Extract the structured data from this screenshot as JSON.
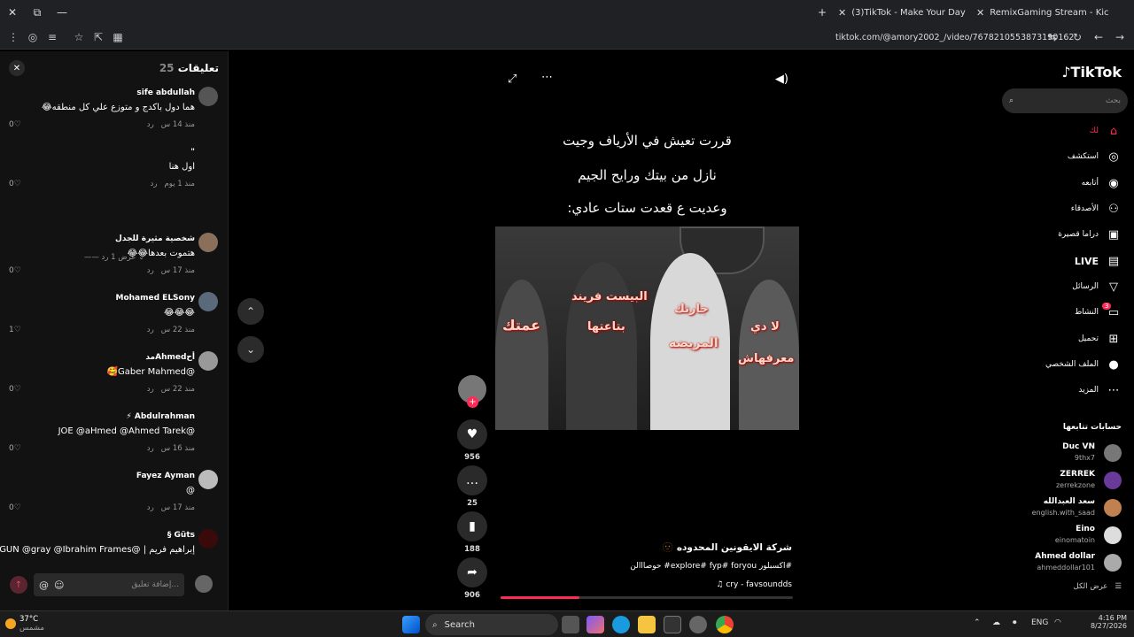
{
  "browser": {
    "tabs": [
      {
        "title": "(3)TikTok - Make Your Day",
        "active": true
      },
      {
        "title": "RemixGaming Stream - Kick Da",
        "active": false
      }
    ],
    "url": "tiktok.com/@amory2002_/video/7678210553873190162"
  },
  "comments": {
    "title": "تعليقات",
    "count": "25",
    "items": [
      {
        "user": "sife abdullah",
        "text": "هما دول باكدج و متوزع علي كل منطقه😂",
        "time": "منذ 14 س",
        "reply": "رد",
        "likes": "0"
      },
      {
        "user": "\"",
        "text": "اول هنا",
        "time": "منذ 1 يوم",
        "reply": "رد",
        "likes": "0"
      },
      {
        "user": "شخصية مثيرة للجدل",
        "text": "هتموت بعدها😂😂",
        "time": "منذ 17 س",
        "reply": "رد",
        "likes": "0"
      },
      {
        "user": "Mohamed ELSony",
        "text": "😂😂😂",
        "time": "منذ 22 س",
        "reply": "رد",
        "likes": "1"
      },
      {
        "user": "أحAhmedمد",
        "text": "@Gaber Mahmed🥰",
        "time": "منذ 22 س",
        "reply": "رد",
        "likes": "0"
      },
      {
        "user": "Abdulrahman ⚡",
        "text": "@JOE @aHmed @Ahmed Tarek",
        "time": "منذ 16 س",
        "reply": "رد",
        "likes": "0"
      },
      {
        "user": "Fayez Ayman",
        "text": "@",
        "time": "منذ 17 س",
        "reply": "رد",
        "likes": "0"
      },
      {
        "user": "Güts §",
        "text": "إبراهيم فريم | @GUN @gray @Ibrahim Frames",
        "time": "",
        "reply": "",
        "likes": ""
      }
    ],
    "more_replies": "عرض 1 رد",
    "input_placeholder": "إضافة تعليق...",
    "mention_symbol": "@"
  },
  "video": {
    "caption_lines": [
      "قررت تعيش في الأرياف وجيت",
      "نازل من بيتك ورايح الجيم",
      "وعديت ع قعدت ستات عادي:"
    ],
    "overlay_labels": [
      "عمتك",
      "البيست فريند",
      "بتاعتها",
      "جارتك",
      "المريضه",
      "لا دي",
      "معرفهاش"
    ],
    "author": "شركة الايقونين المحدوده 🫥",
    "tags": "#اكسبلور explore# fyp# foryou# حوصااالن",
    "music": "♫ cry - favsoundds",
    "progress": 0.27
  },
  "actions": {
    "likes": "956",
    "comments": "25",
    "saves": "188",
    "shares": "906"
  },
  "sidebar": {
    "logo": "TikTok",
    "search_placeholder": "بحث",
    "nav": [
      {
        "label": "لك",
        "icon": "home-icon",
        "accent": "#fe2c55"
      },
      {
        "label": "استكشف",
        "icon": "compass-icon"
      },
      {
        "label": "أتابعه",
        "icon": "following-icon"
      },
      {
        "label": "الأصدقاء",
        "icon": "friends-icon"
      },
      {
        "label": "دراما قصيرة",
        "icon": "drama-icon"
      },
      {
        "label": "LIVE",
        "icon": "live-icon"
      },
      {
        "label": "الرسائل",
        "icon": "messages-icon"
      },
      {
        "label": "النشاط",
        "icon": "activity-icon",
        "badge": "3"
      },
      {
        "label": "تحميل",
        "icon": "upload-icon"
      },
      {
        "label": "الملف الشخصي",
        "icon": "profile-icon"
      },
      {
        "label": "المزيد",
        "icon": "more-icon"
      }
    ],
    "following_title": "حسابات تتابعها",
    "following": [
      {
        "name": "Duc VN",
        "handle": "9thx7"
      },
      {
        "name": "ZERREK",
        "handle": "zerrekzone"
      },
      {
        "name": "سعد العبدالله",
        "handle": "english.with_saad"
      },
      {
        "name": "Eino",
        "handle": "einomatoin"
      },
      {
        "name": "Ahmed dollar",
        "handle": "ahmeddollar101"
      }
    ],
    "see_all": "عرض الكل"
  },
  "taskbar": {
    "temp": "37°C",
    "weather": "مشمس",
    "search": "Search",
    "lang": "ENG",
    "time": "4:16 PM",
    "date": "8/27/2026"
  }
}
